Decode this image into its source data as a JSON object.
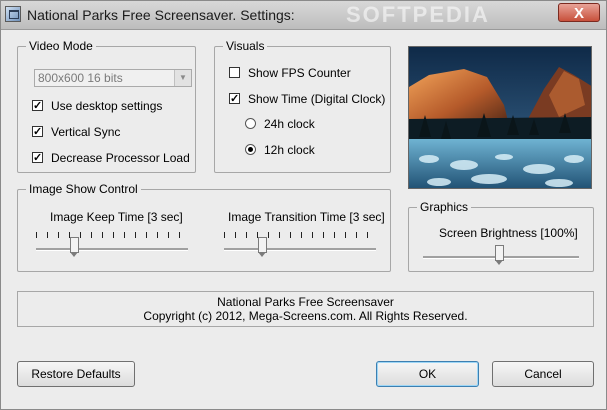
{
  "window": {
    "title": "National Parks Free Screensaver. Settings:",
    "close_label": "X"
  },
  "video_mode": {
    "legend": "Video Mode",
    "resolution": "800x600 16 bits",
    "use_desktop": {
      "label": "Use desktop settings",
      "checked": true
    },
    "vsync": {
      "label": "Vertical Sync",
      "checked": true
    },
    "decrease_load": {
      "label": "Decrease Processor Load",
      "checked": true
    }
  },
  "visuals": {
    "legend": "Visuals",
    "show_fps": {
      "label": "Show FPS Counter",
      "checked": false
    },
    "show_time": {
      "label": "Show Time (Digital Clock)",
      "checked": true
    },
    "clock_24": {
      "label": "24h clock",
      "selected": false
    },
    "clock_12": {
      "label": "12h clock",
      "selected": true
    }
  },
  "image_show": {
    "legend": "Image Show Control",
    "keep_time": {
      "label": "Image Keep Time [3 sec]",
      "value": 3
    },
    "transition_time": {
      "label": "Image Transition Time [3 sec]",
      "value": 3
    }
  },
  "graphics": {
    "legend": "Graphics",
    "brightness": {
      "label": "Screen Brightness [100%]",
      "value_percent": 100
    }
  },
  "info": {
    "line1": "National Parks Free Screensaver",
    "line2": "Copyright (c) 2012, Mega-Screens.com. All Rights Reserved."
  },
  "buttons": {
    "restore": "Restore Defaults",
    "ok": "OK",
    "cancel": "Cancel"
  },
  "watermark": "SOFTPEDIA"
}
